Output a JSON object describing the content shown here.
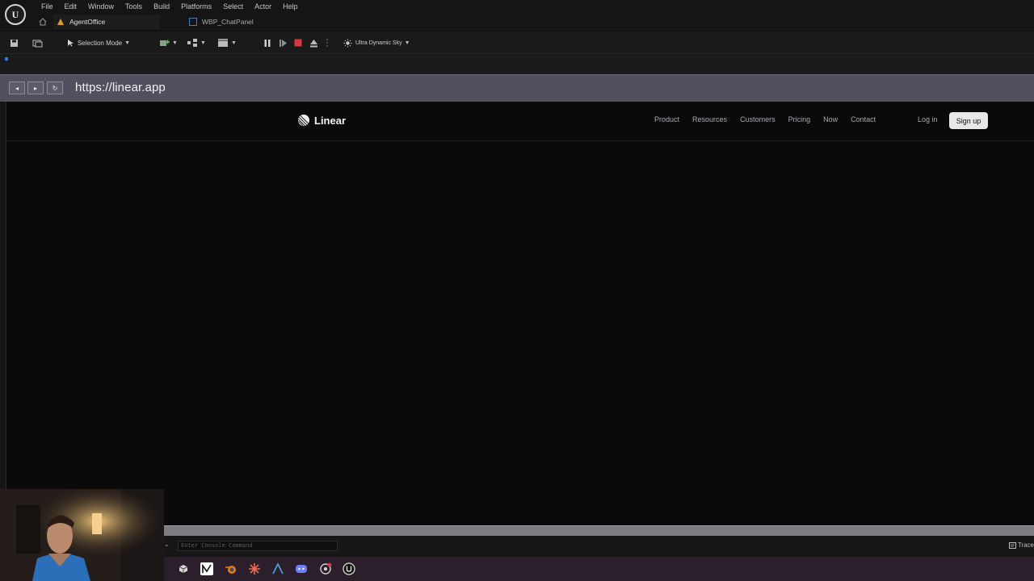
{
  "editor": {
    "logo": "U",
    "menus": [
      "File",
      "Edit",
      "Window",
      "Tools",
      "Build",
      "Platforms",
      "Select",
      "Actor",
      "Help"
    ],
    "tabs": {
      "level": "AgentOffice",
      "blueprint": "WBP_ChatPanel"
    },
    "toolbar": {
      "mode": "Selection Mode",
      "sky": "Ultra Dynamic Sky"
    }
  },
  "browser": {
    "url": "https://linear.app"
  },
  "site": {
    "brand": "Linear",
    "nav": [
      "Product",
      "Resources",
      "Customers",
      "Pricing",
      "Now",
      "Contact"
    ],
    "login": "Log in",
    "signup": "Sign up"
  },
  "console": {
    "placeholder": "Enter Console Command",
    "trace": "Trace"
  },
  "colors": {
    "accent_stop": "#d9363e",
    "signup_bg": "#e8e8ea",
    "page_bg": "#0a0a0b"
  }
}
